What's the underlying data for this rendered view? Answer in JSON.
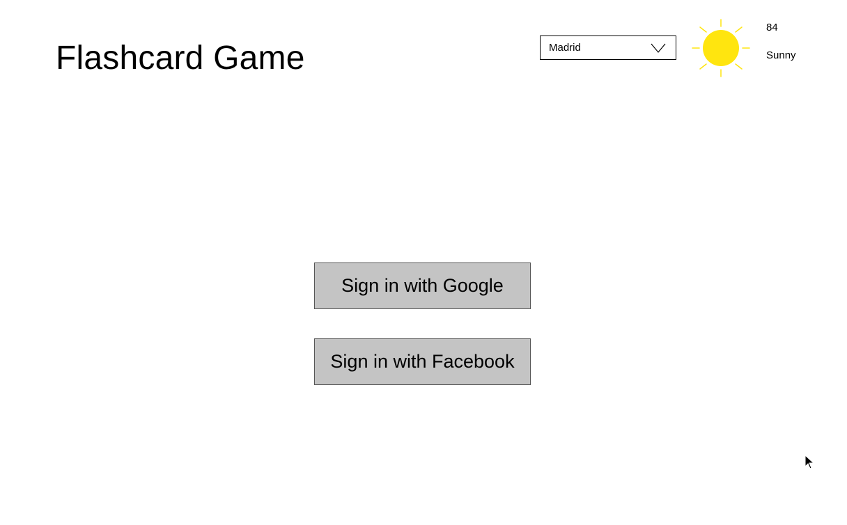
{
  "app": {
    "title": "Flashcard Game"
  },
  "weather": {
    "city_selected": "Madrid",
    "temperature": "84",
    "condition": "Sunny",
    "icon": "sun-icon",
    "sun_color": "#ffe50f"
  },
  "auth": {
    "google_label": "Sign in with Google",
    "facebook_label": "Sign in with Facebook"
  },
  "colors": {
    "button_fill": "#c4c4c4",
    "background": "#ffffff"
  }
}
